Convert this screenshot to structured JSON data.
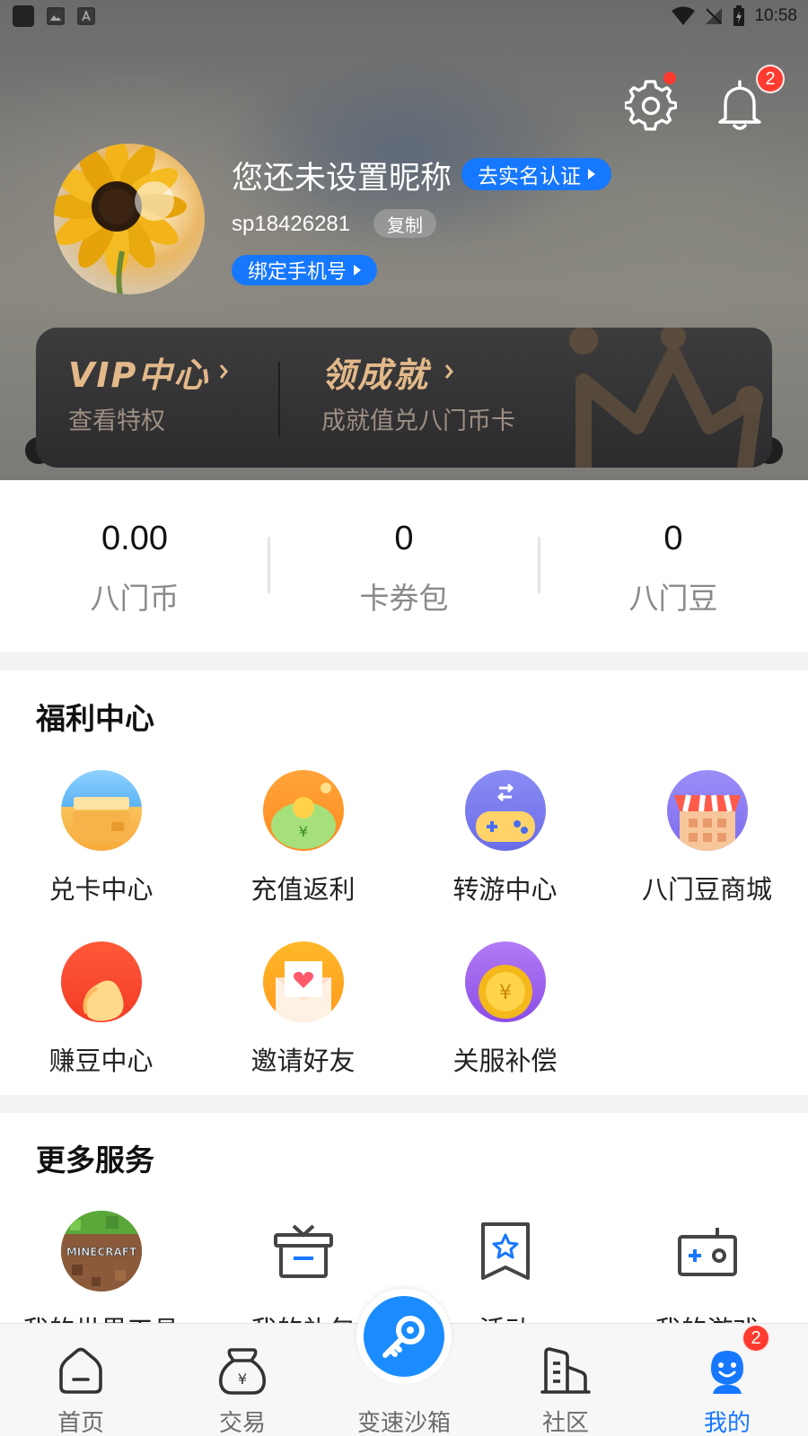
{
  "status_bar": {
    "time": "10:58"
  },
  "header": {
    "notification_count": "2",
    "nickname": "您还未设置昵称",
    "verify_label": "去实名认证",
    "user_id": "sp18426281",
    "copy_label": "复制",
    "bind_phone_label": "绑定手机号"
  },
  "vip_card": {
    "vip_title": "VIP中心",
    "vip_sub": "查看特权",
    "achieve_title": "领成就",
    "achieve_sub": "成就值兑八门币卡"
  },
  "stats": [
    {
      "value": "0.00",
      "label": "八门币"
    },
    {
      "value": "0",
      "label": "卡券包"
    },
    {
      "value": "0",
      "label": "八门豆"
    }
  ],
  "welfare": {
    "title": "福利中心",
    "items": [
      {
        "label": "兑卡中心",
        "icon": "card-exchange-icon"
      },
      {
        "label": "充值返利",
        "icon": "recharge-rebate-icon"
      },
      {
        "label": "转游中心",
        "icon": "game-transfer-icon"
      },
      {
        "label": "八门豆商城",
        "icon": "bean-shop-icon"
      },
      {
        "label": "赚豆中心",
        "icon": "earn-bean-icon"
      },
      {
        "label": "邀请好友",
        "icon": "invite-friend-icon"
      },
      {
        "label": "关服补偿",
        "icon": "compensation-icon"
      }
    ]
  },
  "more_services": {
    "title": "更多服务",
    "items": [
      {
        "label": "我的世界工具",
        "icon": "minecraft-icon"
      },
      {
        "label": "我的礼包",
        "icon": "gift-icon"
      },
      {
        "label": "活动",
        "icon": "activity-icon"
      },
      {
        "label": "我的游戏",
        "icon": "game-console-icon"
      }
    ]
  },
  "bottom_nav": {
    "items": [
      {
        "label": "首页"
      },
      {
        "label": "交易"
      },
      {
        "label": "变速沙箱"
      },
      {
        "label": "社区"
      },
      {
        "label": "我的"
      }
    ],
    "mine_badge": "2",
    "active": "我的"
  },
  "colors": {
    "accent": "#1677ff",
    "badge": "#ff3b30",
    "vip_gold": "#e3b98a"
  }
}
